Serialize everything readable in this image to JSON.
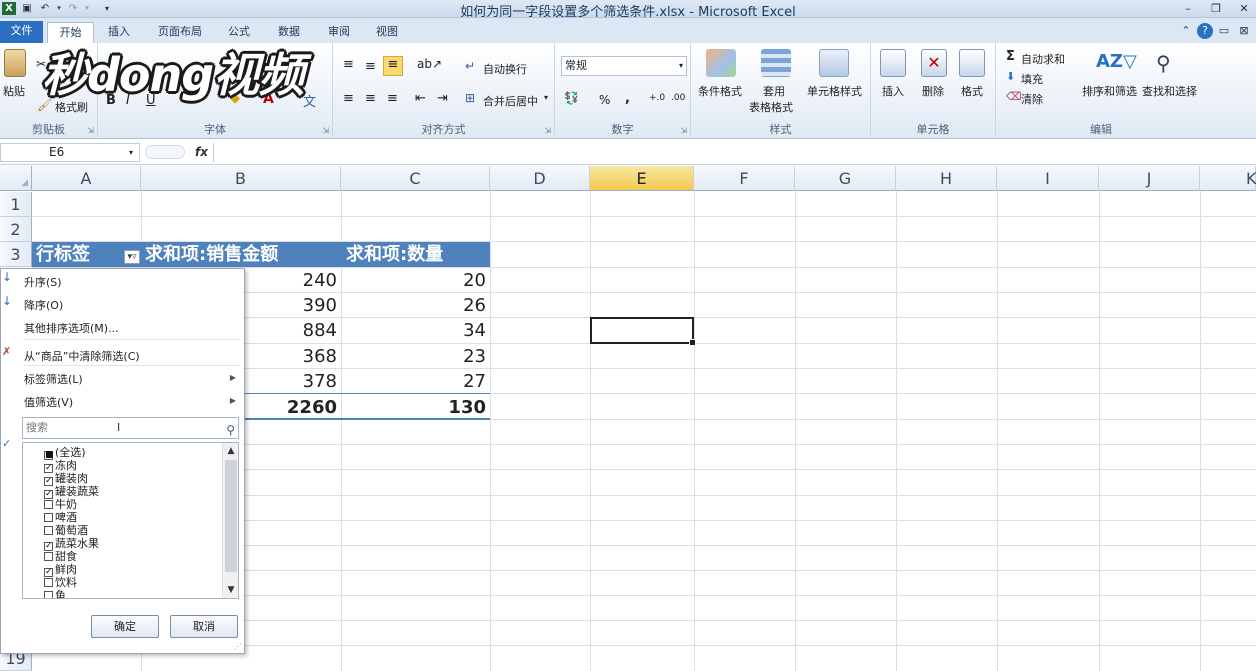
{
  "window": {
    "title": "如何为同一字段设置多个筛选条件.xlsx - Microsoft Excel"
  },
  "tabs": [
    "文件",
    "开始",
    "插入",
    "页面布局",
    "公式",
    "数据",
    "审阅",
    "视图"
  ],
  "logo_text": "秒dong视频",
  "ribbon": {
    "clipboard": {
      "label": "剪贴板",
      "paste": "粘贴",
      "format_painter": "格式刷"
    },
    "font": {
      "label": "字体"
    },
    "alignment": {
      "label": "对齐方式",
      "wrap": "自动换行",
      "merge": "合并后居中"
    },
    "number": {
      "label": "数字",
      "format": "常规"
    },
    "styles": {
      "label": "样式",
      "conditional": "条件格式",
      "table_line1": "套用",
      "table_line2": "表格格式",
      "cell_styles": "单元格样式"
    },
    "cells": {
      "label": "单元格",
      "insert": "插入",
      "delete": "删除",
      "format": "格式"
    },
    "editing": {
      "label": "编辑",
      "autosum": "自动求和",
      "fill": "填充",
      "clear": "清除",
      "sort_filter": "排序和筛选",
      "find_select": "查找和选择"
    }
  },
  "formula_bar": {
    "name_box": "E6",
    "fx": "fx"
  },
  "columns": [
    "A",
    "B",
    "C",
    "D",
    "E",
    "F",
    "G",
    "H",
    "I",
    "J",
    "K"
  ],
  "rows": [
    "1",
    "2",
    "3",
    "19"
  ],
  "pivot": {
    "header": {
      "row_label": "行标签",
      "sum_sales": "求和项:销售金额",
      "sum_qty": "求和项:数量"
    },
    "rows": [
      {
        "sales": "240",
        "qty": "20"
      },
      {
        "sales": "390",
        "qty": "26"
      },
      {
        "sales": "884",
        "qty": "34"
      },
      {
        "sales": "368",
        "qty": "23"
      },
      {
        "sales": "378",
        "qty": "27"
      }
    ],
    "total": {
      "sales": "2260",
      "qty": "130"
    }
  },
  "dropdown": {
    "sort_asc": "升序(S)",
    "sort_desc": "降序(O)",
    "more_sort": "其他排序选项(M)...",
    "clear_filter": "从“商品”中清除筛选(C)",
    "label_filter": "标签筛选(L)",
    "value_filter": "值筛选(V)",
    "search_placeholder": "搜索",
    "items": [
      {
        "label": "(全选)",
        "state": "partial"
      },
      {
        "label": "冻肉",
        "state": "checked"
      },
      {
        "label": "罐装肉",
        "state": "checked"
      },
      {
        "label": "罐装蔬菜",
        "state": "checked"
      },
      {
        "label": "牛奶",
        "state": "unchecked"
      },
      {
        "label": "啤酒",
        "state": "unchecked"
      },
      {
        "label": "葡萄酒",
        "state": "unchecked"
      },
      {
        "label": "蔬菜水果",
        "state": "checked"
      },
      {
        "label": "甜食",
        "state": "unchecked"
      },
      {
        "label": "鲜肉",
        "state": "checked"
      },
      {
        "label": "饮料",
        "state": "unchecked"
      },
      {
        "label": "鱼",
        "state": "unchecked"
      }
    ],
    "ok": "确定",
    "cancel": "取消"
  }
}
